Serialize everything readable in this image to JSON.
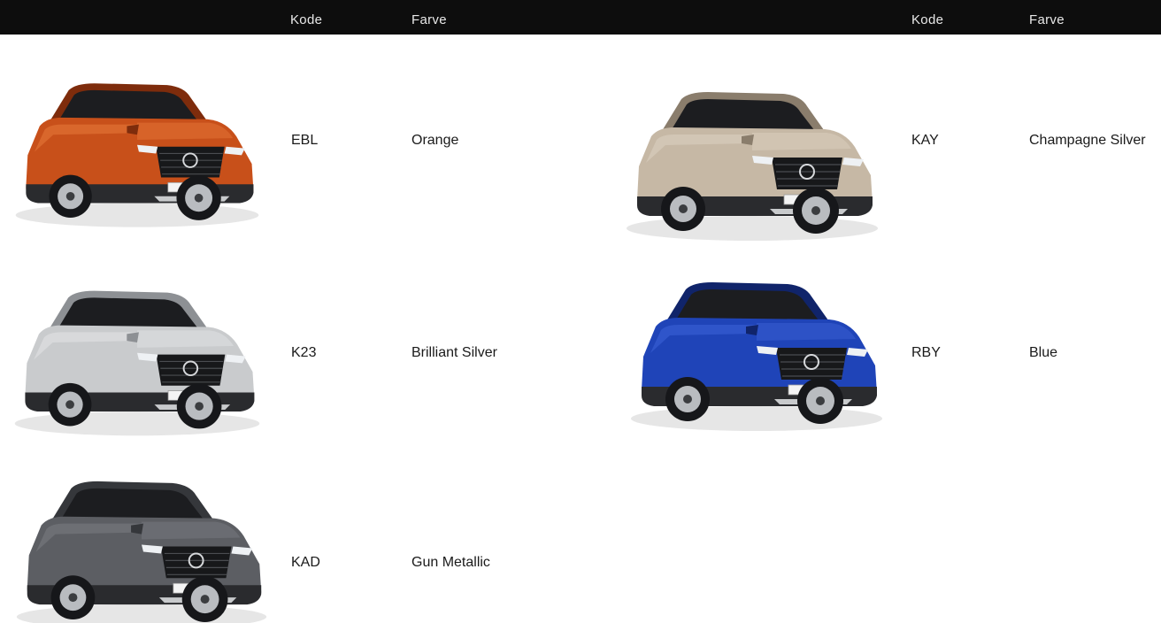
{
  "header": {
    "code_label_left": "Kode",
    "color_label_left": "Farve",
    "code_label_right": "Kode",
    "color_label_right": "Farve"
  },
  "swatches": [
    {
      "code": "EBL",
      "color_name": "Orange",
      "body_color": "#c8501a",
      "body_dark": "#7e2c0c",
      "body_light": "#e87a3c",
      "image_label": "car-orange-image"
    },
    {
      "code": "KAY",
      "color_name": "Champagne Silver",
      "body_color": "#c6b8a5",
      "body_dark": "#8a7d6c",
      "body_light": "#ddd2c3",
      "image_label": "car-champagne-silver-image"
    },
    {
      "code": "K23",
      "color_name": "Brilliant Silver",
      "body_color": "#c9cbcd",
      "body_dark": "#8d9094",
      "body_light": "#e4e6e8",
      "image_label": "car-brilliant-silver-image"
    },
    {
      "code": "RBY",
      "color_name": "Blue",
      "body_color": "#1f44b8",
      "body_dark": "#10246a",
      "body_light": "#3d64d8",
      "image_label": "car-blue-image"
    },
    {
      "code": "KAD",
      "color_name": "Gun Metallic",
      "body_color": "#5c5e63",
      "body_dark": "#35373b",
      "body_light": "#7c7e84",
      "image_label": "car-gun-metallic-image"
    }
  ]
}
